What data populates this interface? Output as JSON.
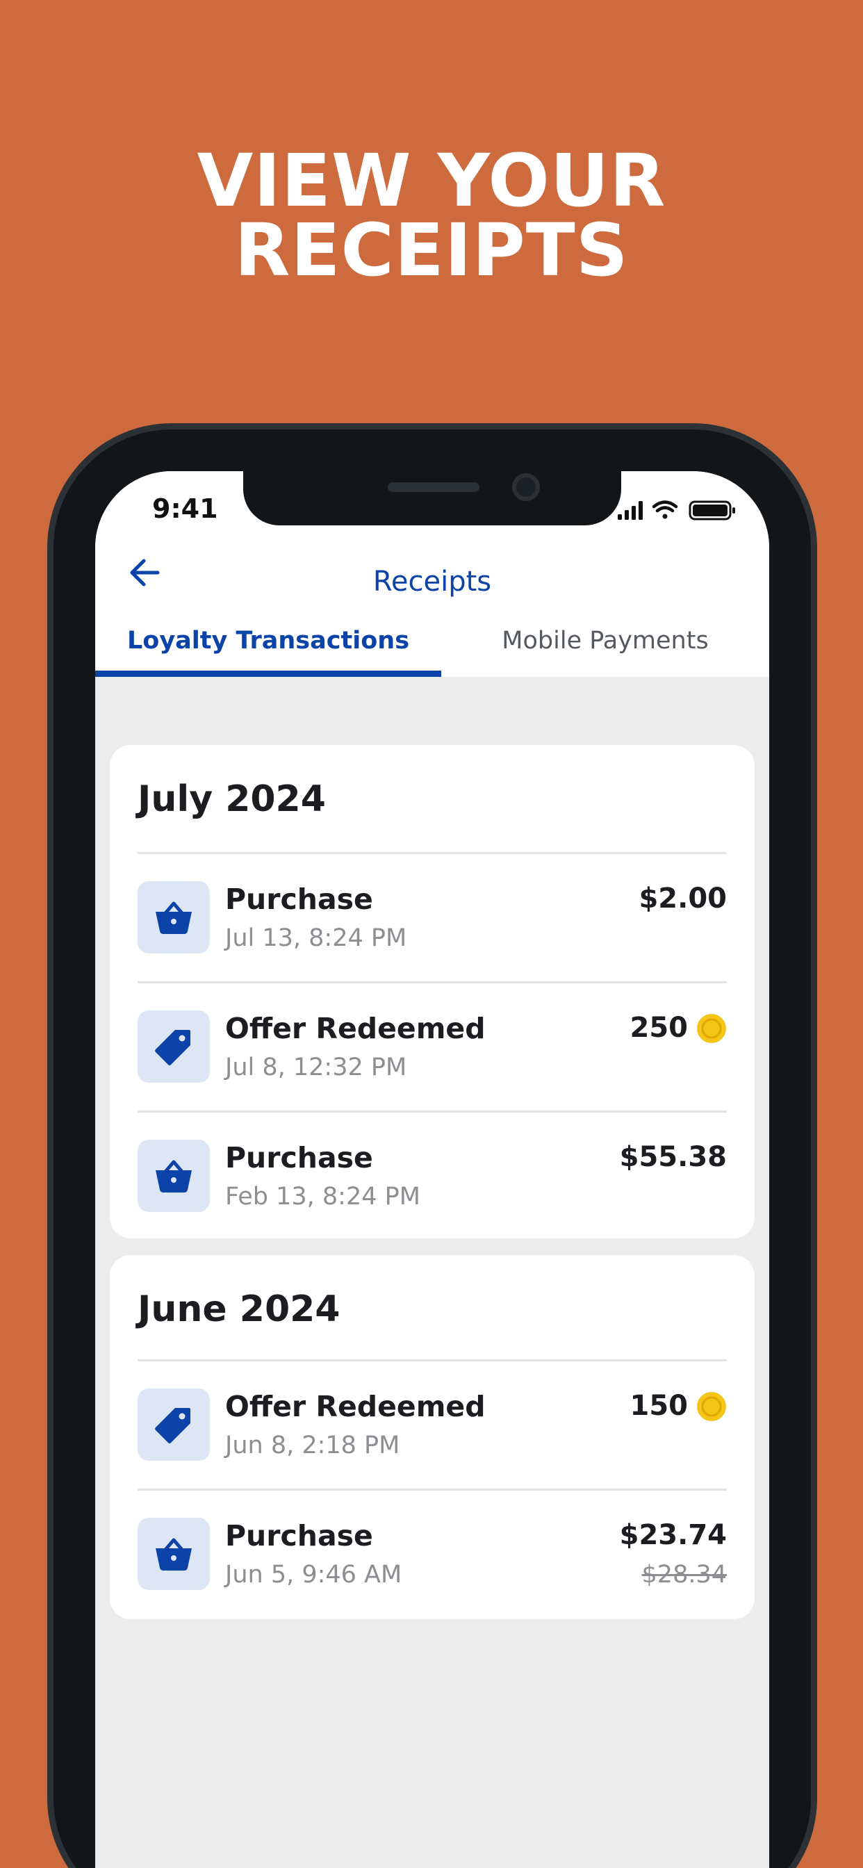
{
  "headline": {
    "line1": "VIEW YOUR",
    "line2": "RECEIPTS"
  },
  "colors": {
    "background": "#cd6b3e",
    "brand": "#0b43a8",
    "coin": "#f5c518"
  },
  "status_bar": {
    "time": "9:41",
    "icons": [
      "signal-icon",
      "wifi-icon",
      "battery-icon"
    ]
  },
  "nav": {
    "title": "Receipts",
    "back_icon": "arrow-left-icon"
  },
  "tabs": [
    {
      "label": "Loyalty Transactions",
      "active": true
    },
    {
      "label": "Mobile Payments",
      "active": false
    }
  ],
  "sections": [
    {
      "month": "July 2024",
      "transactions": [
        {
          "icon": "basket-icon",
          "title": "Purchase",
          "date": "Jul 13, 8:24 PM",
          "amount": "$2.00"
        },
        {
          "icon": "tag-icon",
          "title": "Offer Redeemed",
          "date": "Jul 8, 12:32 PM",
          "amount": "250",
          "points": true
        },
        {
          "icon": "basket-icon",
          "title": "Purchase",
          "date": "Feb 13, 8:24 PM",
          "amount": "$55.38"
        }
      ]
    },
    {
      "month": "June 2024",
      "transactions": [
        {
          "icon": "tag-icon",
          "title": "Offer Redeemed",
          "date": "Jun 8, 2:18 PM",
          "amount": "150",
          "points": true
        },
        {
          "icon": "basket-icon",
          "title": "Purchase",
          "date": "Jun 5, 9:46 AM",
          "amount": "$23.74",
          "original_amount": "$28.34"
        }
      ]
    }
  ]
}
